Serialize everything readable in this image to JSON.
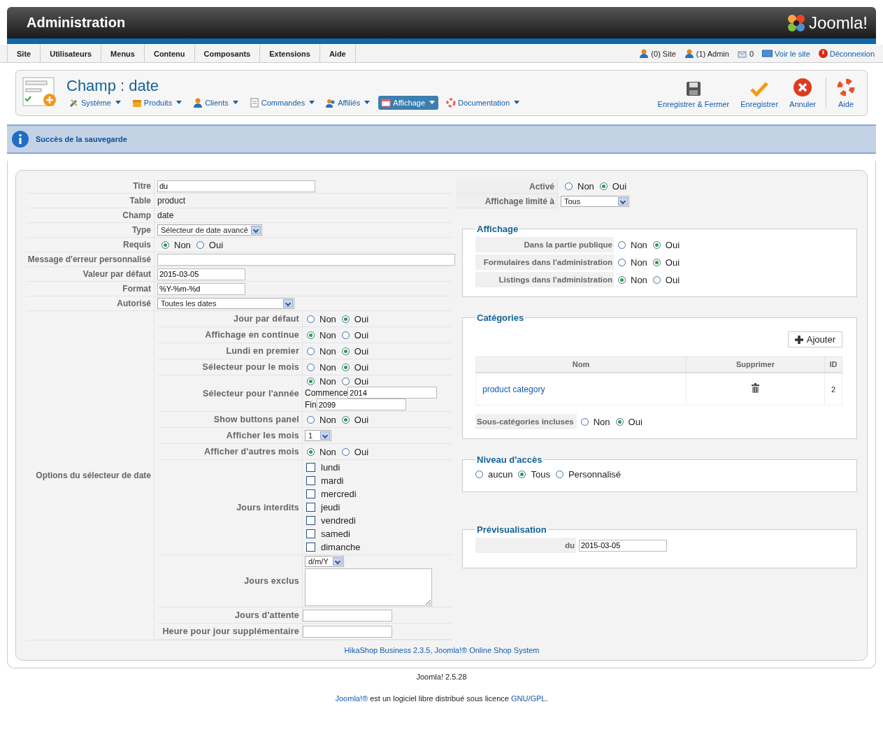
{
  "header": {
    "title": "Administration",
    "logo": "Joomla!"
  },
  "menu": [
    "Site",
    "Utilisateurs",
    "Menus",
    "Contenu",
    "Composants",
    "Extensions",
    "Aide"
  ],
  "status": [
    {
      "kind": "user",
      "text": "(0) Site"
    },
    {
      "kind": "user",
      "text": "(1) Admin"
    },
    {
      "kind": "mail",
      "text": "0"
    },
    {
      "kind": "screen",
      "text": "Voir le site"
    },
    {
      "kind": "logout",
      "text": "Déconnexion"
    }
  ],
  "toolbar": {
    "title": "Champ : date",
    "submenu": [
      {
        "kind": "tools",
        "label": "Système",
        "selected": false
      },
      {
        "kind": "box",
        "label": "Produits",
        "selected": false
      },
      {
        "kind": "user",
        "label": "Clients",
        "selected": false
      },
      {
        "kind": "doc",
        "label": "Commandes",
        "selected": false
      },
      {
        "kind": "users",
        "label": "Affiliés",
        "selected": false
      },
      {
        "kind": "window",
        "label": "Affichage",
        "selected": true
      },
      {
        "kind": "help",
        "label": "Documentation",
        "selected": false
      }
    ],
    "buttons": [
      {
        "kind": "save",
        "label": "Enregistrer & Fermer"
      },
      {
        "kind": "apply",
        "label": "Enregistrer"
      },
      {
        "kind": "cancel",
        "label": "Annuler"
      },
      {
        "kind": "help",
        "label": "Aide"
      }
    ]
  },
  "message": "Succès de la sauvegarde",
  "fields": [
    {
      "kind": "input",
      "label": "Titre",
      "value": "du"
    },
    {
      "kind": "text",
      "label": "Table",
      "value": "product"
    },
    {
      "kind": "text",
      "label": "Champ",
      "value": "date"
    },
    {
      "kind": "select",
      "label": "Type",
      "value": "Sélecteur de date avancé"
    },
    {
      "kind": "radio",
      "label": "Requis",
      "options": [
        {
          "label": "Non",
          "selected": true
        },
        {
          "label": "Oui",
          "selected": false
        }
      ]
    },
    {
      "kind": "input",
      "label": "Message d'erreur personnalisé"
    },
    {
      "kind": "input",
      "label": "Valeur par défaut",
      "value": "2015-03-05"
    },
    {
      "kind": "input",
      "label": "Format",
      "value": "%Y-%m-%d"
    },
    {
      "kind": "select",
      "label": "Autorisé",
      "value": "Toutes les dates"
    },
    {
      "kind": "options",
      "label": "Options du sélecteur de date",
      "fields": [
        {
          "kind": "radio",
          "label": "Jour par défaut",
          "options": [
            {
              "label": "Non",
              "selected": false
            },
            {
              "label": "Oui",
              "selected": true
            }
          ]
        },
        {
          "kind": "radio",
          "label": "Affichage en continue",
          "options": [
            {
              "label": "Non",
              "selected": true
            },
            {
              "label": "Oui",
              "selected": false
            }
          ]
        },
        {
          "kind": "radio",
          "label": "Lundi en premier",
          "options": [
            {
              "label": "Non",
              "selected": false
            },
            {
              "label": "Oui",
              "selected": true
            }
          ]
        },
        {
          "kind": "radio",
          "label": "Sélecteur pour le mois",
          "options": [
            {
              "label": "Non",
              "selected": false
            },
            {
              "label": "Oui",
              "selected": true
            }
          ]
        },
        {
          "kind": "radio_range",
          "label": "Sélecteur pour l'année",
          "options": [
            {
              "label": "Non",
              "selected": true
            },
            {
              "label": "Oui",
              "selected": false
            }
          ],
          "ranges": [
            {
              "label": "Commence",
              "value": "2014"
            },
            {
              "label": "Fin",
              "value": "2099"
            }
          ]
        },
        {
          "kind": "radio",
          "label": "Show buttons panel",
          "options": [
            {
              "label": "Non",
              "selected": false
            },
            {
              "label": "Oui",
              "selected": true
            }
          ]
        },
        {
          "kind": "select",
          "label": "Afficher les mois",
          "value": "1"
        },
        {
          "kind": "radio",
          "label": "Afficher d'autres mois",
          "options": [
            {
              "label": "Non",
              "selected": true
            },
            {
              "label": "Oui",
              "selected": false
            }
          ]
        },
        {
          "kind": "checklist",
          "label": "Jours interdits",
          "items": [
            {
              "label": "lundi",
              "checked": false
            },
            {
              "label": "mardi",
              "checked": false
            },
            {
              "label": "mercredi",
              "checked": false
            },
            {
              "label": "jeudi",
              "checked": false
            },
            {
              "label": "vendredi",
              "checked": false
            },
            {
              "label": "samedi",
              "checked": false
            },
            {
              "label": "dimanche",
              "checked": false
            }
          ]
        },
        {
          "kind": "select_textarea",
          "label": "Jours exclus",
          "value": "d/m/Y"
        },
        {
          "kind": "input",
          "label": "Jours d'attente"
        },
        {
          "kind": "input",
          "label": "Heure pour jour supplémentaire"
        }
      ]
    }
  ],
  "right": [
    {
      "kind": "radio",
      "label": "Activé",
      "options": [
        {
          "label": "Non",
          "selected": false
        },
        {
          "label": "Oui",
          "selected": true
        }
      ]
    },
    {
      "kind": "select",
      "label": "Affichage limité à",
      "value": "Tous"
    }
  ],
  "affichage": {
    "legend": "Affichage",
    "fields": [
      {
        "label": "Dans la partie publique",
        "options": [
          {
            "label": "Non",
            "selected": false
          },
          {
            "label": "Oui",
            "selected": true
          }
        ]
      },
      {
        "label": "Formulaires dans l'administration",
        "options": [
          {
            "label": "Non",
            "selected": false
          },
          {
            "label": "Oui",
            "selected": true
          }
        ]
      },
      {
        "label": "Listings dans l'administration",
        "options": [
          {
            "label": "Non",
            "selected": true
          },
          {
            "label": "Oui",
            "selected": false
          }
        ]
      }
    ]
  },
  "categories": {
    "legend": "Catégories",
    "button": "Ajouter",
    "columns": [
      "Nom",
      "Supprimer",
      "ID"
    ],
    "rows": [
      {
        "name": "product category",
        "id": "2"
      }
    ],
    "sub": {
      "label": "Sous-catégories incluses",
      "options": [
        {
          "label": "Non",
          "selected": false
        },
        {
          "label": "Oui",
          "selected": true
        }
      ]
    }
  },
  "access": {
    "legend": "Niveau d'accès",
    "options": [
      {
        "label": "aucun",
        "selected": false
      },
      {
        "label": "Tous",
        "selected": true
      },
      {
        "label": "Personnalisé",
        "selected": false
      }
    ]
  },
  "preview": {
    "legend": "Prévisualisation",
    "label": "du",
    "value": "2015-03-05"
  },
  "credits": "HikaShop Business 2.3.5, Joomla!® Online Shop System",
  "version": "Joomla! 2.5.28",
  "license": [
    {
      "kind": "link",
      "text": "Joomla!®"
    },
    {
      "kind": "text",
      "text": " est un logiciel libre distribué sous licence "
    },
    {
      "kind": "link",
      "text": "GNU/GPL"
    },
    {
      "kind": "text",
      "text": "."
    }
  ]
}
